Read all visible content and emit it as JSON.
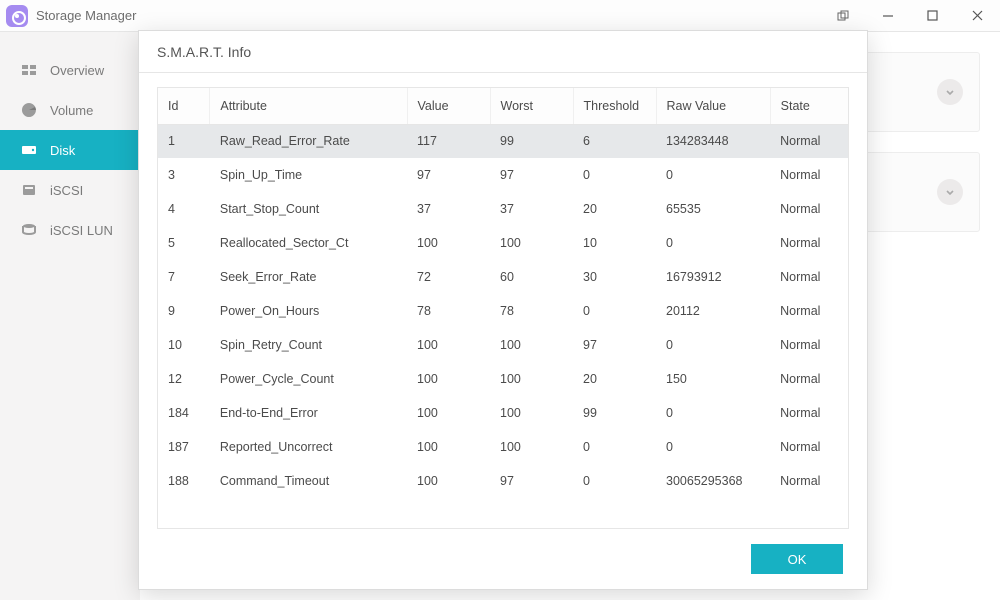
{
  "app": {
    "title": "Storage Manager"
  },
  "sidebar": {
    "items": [
      {
        "label": "Overview",
        "icon": "overview"
      },
      {
        "label": "Volume",
        "icon": "volume"
      },
      {
        "label": "Disk",
        "icon": "disk",
        "active": true
      },
      {
        "label": "iSCSI",
        "icon": "iscsi"
      },
      {
        "label": "iSCSI LUN",
        "icon": "iscsi-lun"
      }
    ]
  },
  "modal": {
    "title": "S.M.A.R.T. Info",
    "ok_label": "OK",
    "columns": [
      "Id",
      "Attribute",
      "Value",
      "Worst",
      "Threshold",
      "Raw Value",
      "State"
    ],
    "rows": [
      {
        "id": "1",
        "attr": "Raw_Read_Error_Rate",
        "val": "117",
        "wor": "99",
        "thr": "6",
        "raw": "134283448",
        "state": "Normal",
        "selected": true
      },
      {
        "id": "3",
        "attr": "Spin_Up_Time",
        "val": "97",
        "wor": "97",
        "thr": "0",
        "raw": "0",
        "state": "Normal"
      },
      {
        "id": "4",
        "attr": "Start_Stop_Count",
        "val": "37",
        "wor": "37",
        "thr": "20",
        "raw": "65535",
        "state": "Normal"
      },
      {
        "id": "5",
        "attr": "Reallocated_Sector_Ct",
        "val": "100",
        "wor": "100",
        "thr": "10",
        "raw": "0",
        "state": "Normal"
      },
      {
        "id": "7",
        "attr": "Seek_Error_Rate",
        "val": "72",
        "wor": "60",
        "thr": "30",
        "raw": "16793912",
        "state": "Normal"
      },
      {
        "id": "9",
        "attr": "Power_On_Hours",
        "val": "78",
        "wor": "78",
        "thr": "0",
        "raw": "20112",
        "state": "Normal"
      },
      {
        "id": "10",
        "attr": "Spin_Retry_Count",
        "val": "100",
        "wor": "100",
        "thr": "97",
        "raw": "0",
        "state": "Normal"
      },
      {
        "id": "12",
        "attr": "Power_Cycle_Count",
        "val": "100",
        "wor": "100",
        "thr": "20",
        "raw": "150",
        "state": "Normal"
      },
      {
        "id": "184",
        "attr": "End-to-End_Error",
        "val": "100",
        "wor": "100",
        "thr": "99",
        "raw": "0",
        "state": "Normal"
      },
      {
        "id": "187",
        "attr": "Reported_Uncorrect",
        "val": "100",
        "wor": "100",
        "thr": "0",
        "raw": "0",
        "state": "Normal"
      },
      {
        "id": "188",
        "attr": "Command_Timeout",
        "val": "100",
        "wor": "97",
        "thr": "0",
        "raw": "30065295368",
        "state": "Normal"
      }
    ]
  }
}
